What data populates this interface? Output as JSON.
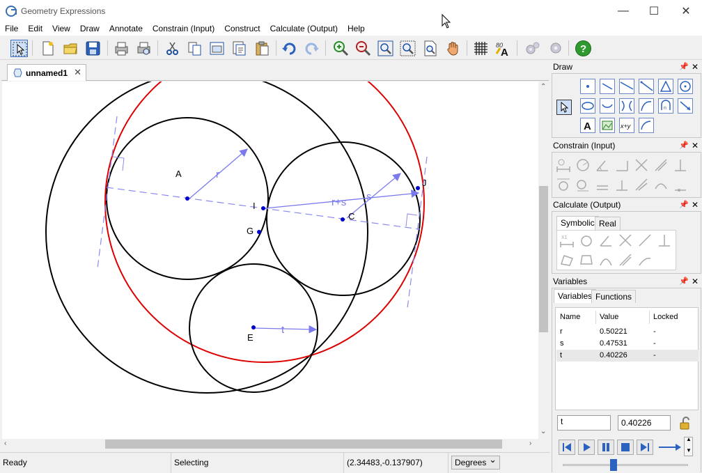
{
  "window": {
    "title": "Geometry Expressions",
    "minimize_glyph": "—",
    "maximize_glyph": "☐",
    "close_glyph": "✕"
  },
  "menu": [
    "File",
    "Edit",
    "View",
    "Draw",
    "Annotate",
    "Constrain (Input)",
    "Construct",
    "Calculate (Output)",
    "Help"
  ],
  "toolbar": {
    "icons": [
      "select-icon",
      "new-file-icon",
      "open-folder-icon",
      "save-icon",
      "print-icon",
      "print-preview-icon",
      "cut-icon",
      "copy-icon",
      "copy-image-icon",
      "copy-special-icon",
      "paste-icon",
      "undo-icon",
      "redo-icon",
      "zoom-in-icon",
      "zoom-out-icon",
      "zoom-fit-icon",
      "zoom-window-icon",
      "zoom-page-icon",
      "pan-hand-icon",
      "grid-icon",
      "text-style-icon",
      "settings-icon",
      "settings-alt-icon",
      "help-icon"
    ]
  },
  "document": {
    "tab_label": "unnamed1",
    "tab_close": "✕"
  },
  "canvas": {
    "points": [
      {
        "label": "A"
      },
      {
        "label": "I"
      },
      {
        "label": "G"
      },
      {
        "label": "C"
      },
      {
        "label": "J"
      },
      {
        "label": "E"
      }
    ],
    "annotations": {
      "r": "r",
      "s": "s",
      "rs": "r+s",
      "t": "t"
    },
    "colors": {
      "circle": "#000000",
      "locus": "#dd0000",
      "annotation": "#7a7aee",
      "point": "#0000cc",
      "construction": "#8a8aee"
    }
  },
  "status": {
    "state": "Ready",
    "mode": "Selecting",
    "coords": "(2.34483,-0.137907)",
    "angle_unit": "Degrees"
  },
  "panels": {
    "draw": {
      "title": "Draw"
    },
    "constrain": {
      "title": "Constrain (Input)"
    },
    "calculate": {
      "title": "Calculate (Output)",
      "tabs": [
        "Symbolic",
        "Real"
      ],
      "active_tab": "Symbolic"
    },
    "variables": {
      "title": "Variables",
      "tabs": [
        "Variables",
        "Functions"
      ],
      "active_tab": "Variables",
      "columns": [
        "Name",
        "Value",
        "Locked"
      ],
      "rows": [
        {
          "name": "r",
          "value": "0.50221",
          "locked": "-"
        },
        {
          "name": "s",
          "value": "0.47531",
          "locked": "-"
        },
        {
          "name": "t",
          "value": "0.40226",
          "locked": "-"
        }
      ],
      "selected_name": "t",
      "selected_value": "0.40226"
    },
    "pin_glyph": "📌"
  }
}
